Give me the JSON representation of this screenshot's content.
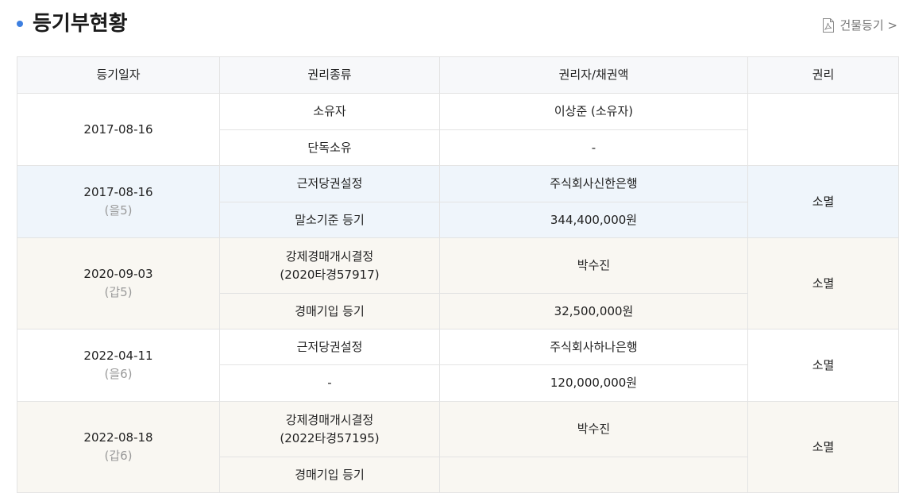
{
  "header": {
    "title": "등기부현황",
    "link_label": "건물등기 >",
    "accent_color": "#3d7fe0",
    "link_icon": "pdf-icon"
  },
  "table": {
    "columns": [
      "등기일자",
      "권리종류",
      "권리자/채권액",
      "권리"
    ],
    "entries": [
      {
        "date": "2017-08-16",
        "sub": "",
        "rows": [
          {
            "type": "소유자",
            "holder": "이상준 (소유자)"
          },
          {
            "type": "단독소유",
            "holder": "-"
          }
        ],
        "status": "",
        "tone": "white"
      },
      {
        "date": "2017-08-16",
        "sub": "(을5)",
        "rows": [
          {
            "type": "근저당권설정",
            "holder": "주식회사신한은행"
          },
          {
            "type": "말소기준 등기",
            "holder": "344,400,000원"
          }
        ],
        "status": "소멸",
        "tone": "blue"
      },
      {
        "date": "2020-09-03",
        "sub": "(갑5)",
        "rows": [
          {
            "type": "강제경매개시결정 (2020타경57917)",
            "type_line1": "강제경매개시결정",
            "type_line2": "(2020타경57917)",
            "holder": "박수진"
          },
          {
            "type": "경매기입 등기",
            "holder": "32,500,000원"
          }
        ],
        "status": "소멸",
        "tone": "beige"
      },
      {
        "date": "2022-04-11",
        "sub": "(을6)",
        "rows": [
          {
            "type": "근저당권설정",
            "holder": "주식회사하나은행"
          },
          {
            "type": "-",
            "holder": "120,000,000원"
          }
        ],
        "status": "소멸",
        "tone": "white"
      },
      {
        "date": "2022-08-18",
        "sub": "(갑6)",
        "rows": [
          {
            "type": "강제경매개시결정 (2022타경57195)",
            "type_line1": "강제경매개시결정",
            "type_line2": "(2022타경57195)",
            "holder": "박수진"
          },
          {
            "type": "경매기입 등기",
            "holder": ""
          }
        ],
        "status": "소멸",
        "tone": "beige"
      }
    ]
  }
}
